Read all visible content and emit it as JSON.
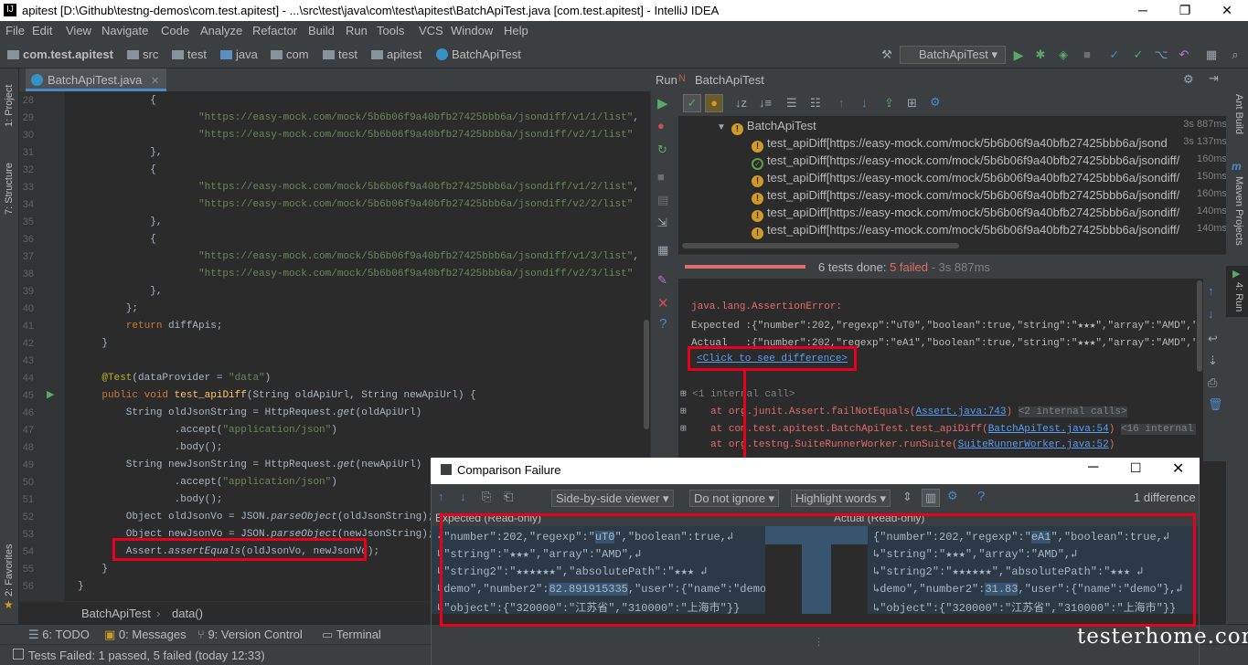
{
  "window": {
    "title": "apitest [D:\\Github\\testng-demos\\com.test.apitest] - ...\\src\\test\\java\\com\\test\\apitest\\BatchApiTest.java [com.test.apitest] - IntelliJ IDEA",
    "icon": "intellij-icon"
  },
  "menu": [
    "File",
    "Edit",
    "View",
    "Navigate",
    "Code",
    "Analyze",
    "Refactor",
    "Build",
    "Run",
    "Tools",
    "VCS",
    "Window",
    "Help"
  ],
  "breadcrumbs": [
    "com.test.apitest",
    "src",
    "test",
    "java",
    "com",
    "test",
    "apitest",
    "BatchApiTest"
  ],
  "run_config": "BatchApiTest",
  "editor": {
    "tab": "BatchApiTest.java",
    "lines": [
      {
        "n": "28",
        "t": "            {"
      },
      {
        "n": "29",
        "t": "                    \"https://easy-mock.com/mock/5b6b06f9a40bfb27425bbb6a/jsondiff/v1/1/list\","
      },
      {
        "n": "30",
        "t": "                    \"https://easy-mock.com/mock/5b6b06f9a40bfb27425bbb6a/jsondiff/v2/1/list\""
      },
      {
        "n": "31",
        "t": "            },"
      },
      {
        "n": "32",
        "t": "            {"
      },
      {
        "n": "33",
        "t": "                    \"https://easy-mock.com/mock/5b6b06f9a40bfb27425bbb6a/jsondiff/v1/2/list\","
      },
      {
        "n": "34",
        "t": "                    \"https://easy-mock.com/mock/5b6b06f9a40bfb27425bbb6a/jsondiff/v2/2/list\""
      },
      {
        "n": "35",
        "t": "            },"
      },
      {
        "n": "36",
        "t": "            {"
      },
      {
        "n": "37",
        "t": "                    \"https://easy-mock.com/mock/5b6b06f9a40bfb27425bbb6a/jsondiff/v1/3/list\","
      },
      {
        "n": "38",
        "t": "                    \"https://easy-mock.com/mock/5b6b06f9a40bfb27425bbb6a/jsondiff/v2/3/list\""
      },
      {
        "n": "39",
        "t": "            },"
      },
      {
        "n": "40",
        "t": "        };"
      },
      {
        "n": "41",
        "t": "        return diffApis;"
      },
      {
        "n": "42",
        "t": "    }"
      },
      {
        "n": "43",
        "t": ""
      },
      {
        "n": "44",
        "t": "    @Test(dataProvider = \"data\")"
      },
      {
        "n": "45",
        "t": "    public void test_apiDiff(String oldApiUrl, String newApiUrl) {"
      },
      {
        "n": "46",
        "t": "        String oldJsonString = HttpRequest.get(oldApiUrl)"
      },
      {
        "n": "47",
        "t": "                .accept(\"application/json\")"
      },
      {
        "n": "48",
        "t": "                .body();"
      },
      {
        "n": "49",
        "t": "        String newJsonString = HttpRequest.get(newApiUrl)"
      },
      {
        "n": "50",
        "t": "                .accept(\"application/json\")"
      },
      {
        "n": "51",
        "t": "                .body();"
      },
      {
        "n": "52",
        "t": "        Object oldJsonVo = JSON.parseObject(oldJsonString);"
      },
      {
        "n": "53",
        "t": "        Object newJsonVo = JSON.parseObject(newJsonString);"
      },
      {
        "n": "54",
        "t": "        Assert.assertEquals(oldJsonVo, newJsonVo);"
      },
      {
        "n": "55",
        "t": "    }"
      },
      {
        "n": "56",
        "t": "}"
      }
    ],
    "crumb_class": "BatchApiTest",
    "crumb_method": "data()"
  },
  "run": {
    "header_label": "Run",
    "header_config": "BatchApiTest",
    "tree_root": "BatchApiTest",
    "tree_root_time": "3s 887ms",
    "tests": [
      {
        "status": "failed",
        "name": "test_apiDiff[https://easy-mock.com/mock/5b6b06f9a40bfb27425bbb6a/jsond",
        "time": "3s 137ms"
      },
      {
        "status": "passed",
        "name": "test_apiDiff[https://easy-mock.com/mock/5b6b06f9a40bfb27425bbb6a/jsondiff/",
        "time": "160ms"
      },
      {
        "status": "failed",
        "name": "test_apiDiff[https://easy-mock.com/mock/5b6b06f9a40bfb27425bbb6a/jsondiff/",
        "time": "150ms"
      },
      {
        "status": "failed",
        "name": "test_apiDiff[https://easy-mock.com/mock/5b6b06f9a40bfb27425bbb6a/jsondiff/",
        "time": "160ms"
      },
      {
        "status": "failed",
        "name": "test_apiDiff[https://easy-mock.com/mock/5b6b06f9a40bfb27425bbb6a/jsondiff/",
        "time": "140ms"
      },
      {
        "status": "failed",
        "name": "test_apiDiff[https://easy-mock.com/mock/5b6b06f9a40bfb27425bbb6a/jsondiff/",
        "time": "140ms"
      }
    ],
    "summary_done": "6 tests done: ",
    "summary_failed": "5 failed",
    "summary_time": " - 3s 887ms",
    "progress_failed_fraction": 1.0
  },
  "console": {
    "error": "java.lang.AssertionError:",
    "expected_label": "Expected :",
    "expected_value": "{\"number\":202,\"regexp\":\"uT0\",\"boolean\":true,\"string\":\"★★★\",\"array\":\"AMD\",\"string",
    "actual_label": "Actual   :",
    "actual_value": "{\"number\":202,\"regexp\":\"eA1\",\"boolean\":true,\"string\":\"★★★\",\"array\":\"AMD\",\"string",
    "diff_link": "<Click to see difference>",
    "internal1": "<1 internal call>",
    "at1_pre": "at org.junit.Assert.failNotEquals(",
    "at1_link": "Assert.java:743",
    "at1_post": ")",
    "at1_tag": "<2 internal calls>",
    "at2_pre": "at com.test.apitest.BatchApiTest.test_apiDiff(",
    "at2_link": "BatchApiTest.java:54",
    "at2_post": ")",
    "at2_tag": "<16 internal calls>",
    "at3_pre": "at org.testng.SuiteRunnerWorker.runSuite(",
    "at3_link": "SuiteRunnerWorker.java:52",
    "at3_post": ")"
  },
  "dialog": {
    "title": "Comparison Failure",
    "viewer": "Side-by-side viewer",
    "ignore": "Do not ignore",
    "highlight": "Highlight words",
    "diff_count": "1 difference",
    "left_label": "Expected (Read-only)",
    "right_label": "Actual (Read-only)",
    "left_lines": [
      [
        "{\"number\":202,\"regexp\":\"",
        "uT0",
        "\",\"boolean\":true,↲"
      ],
      [
        "↳\"string\":\"★★★\",\"array\":\"AMD\",↲",
        "",
        ""
      ],
      [
        "↳\"string2\":\"★★★★★★\",\"absolutePath\":\"★★★ ↲",
        "",
        ""
      ],
      [
        "↳demo\",\"number2\":",
        "82.891915335",
        ",\"user\":{\"name\":\"demo\"},↲"
      ],
      [
        "↳\"object\":{\"320000\":\"江苏省\",\"310000\":\"上海市\"}}",
        "",
        ""
      ]
    ],
    "right_lines": [
      [
        "{\"number\":202,\"regexp\":\"",
        "eA1",
        "\",\"boolean\":true,↲"
      ],
      [
        "↳\"string\":\"★★★\",\"array\":\"AMD\",↲",
        "",
        ""
      ],
      [
        "↳\"string2\":\"★★★★★★\",\"absolutePath\":\"★★★ ↲",
        "",
        ""
      ],
      [
        "↳demo\",\"number2\":",
        "31.83",
        ",\"user\":{\"name\":\"demo\"},↲"
      ],
      [
        "↳\"object\":{\"320000\":\"江苏省\",\"310000\":\"上海市\"}}",
        "",
        ""
      ]
    ]
  },
  "sidebars": {
    "left": [
      "1: Project",
      "7: Structure",
      "2: Favorites"
    ],
    "right": [
      "Ant Build",
      "Maven Projects",
      "4: Run"
    ]
  },
  "bottom_tabs": [
    "6: TODO",
    "0: Messages",
    "9: Version Control",
    "Terminal"
  ],
  "status": "Tests Failed: 1 passed, 5 failed (today 12:33)",
  "watermark": "testerhome.com",
  "colors": {
    "failed": "#e06c6c",
    "warn": "#d19a26",
    "pass": "#5f9e4a",
    "link": "#589df6",
    "highlight_box": "#e8001c"
  }
}
